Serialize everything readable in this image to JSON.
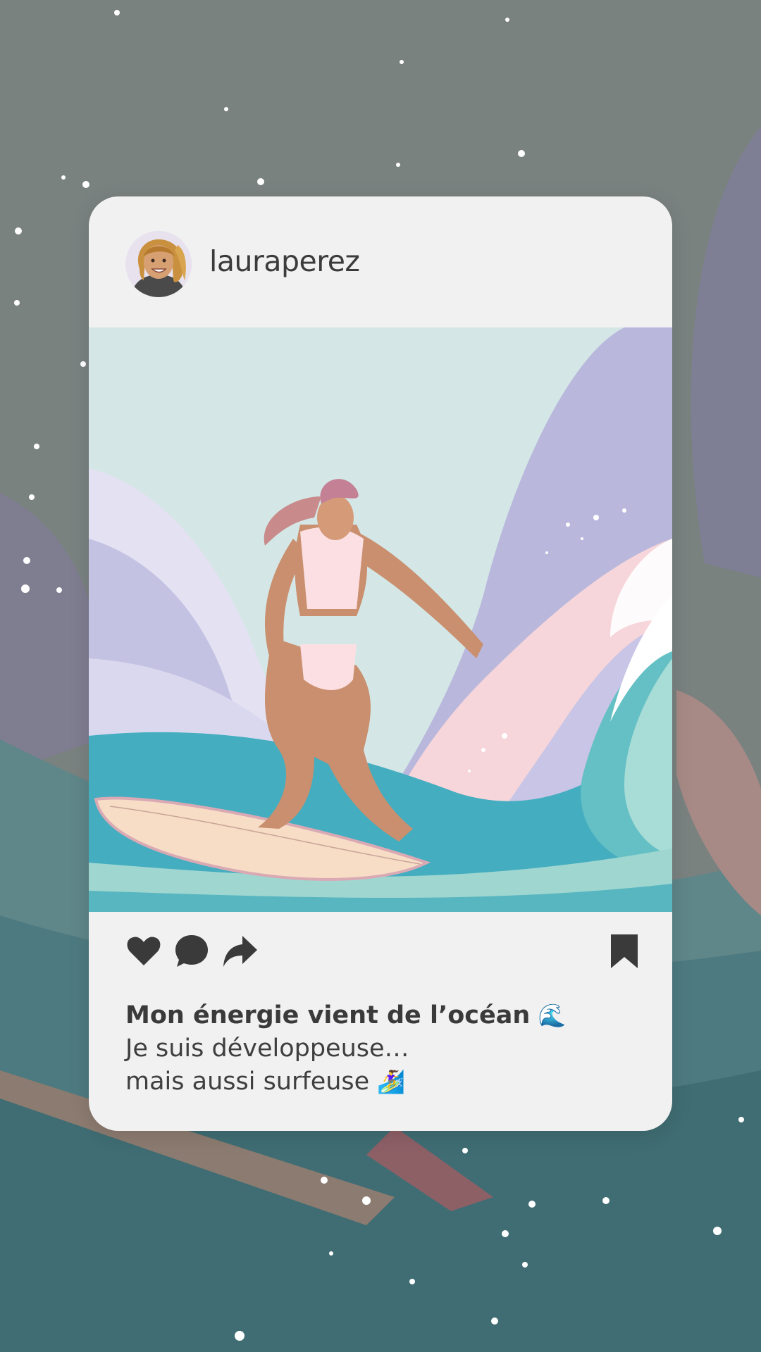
{
  "post": {
    "username": "lauraperez",
    "caption_title": "Mon énergie vient de l’océan",
    "caption_title_emoji": "🌊",
    "caption_line1": "Je suis développeuse…",
    "caption_line2": "mais aussi surfeuse",
    "caption_line2_emoji": "🏄‍♀️"
  },
  "actions": {
    "like_icon": "heart-icon",
    "comment_icon": "comment-icon",
    "share_icon": "share-icon",
    "save_icon": "bookmark-icon"
  },
  "colors": {
    "background": "#7a8280",
    "card": "#f1f1f1",
    "text": "#3b3b3b",
    "sky": "#d4e7e6",
    "wave_purple": "#b9b8dc",
    "wave_teal": "#44adc0",
    "wave_pink": "#f6d6da"
  }
}
